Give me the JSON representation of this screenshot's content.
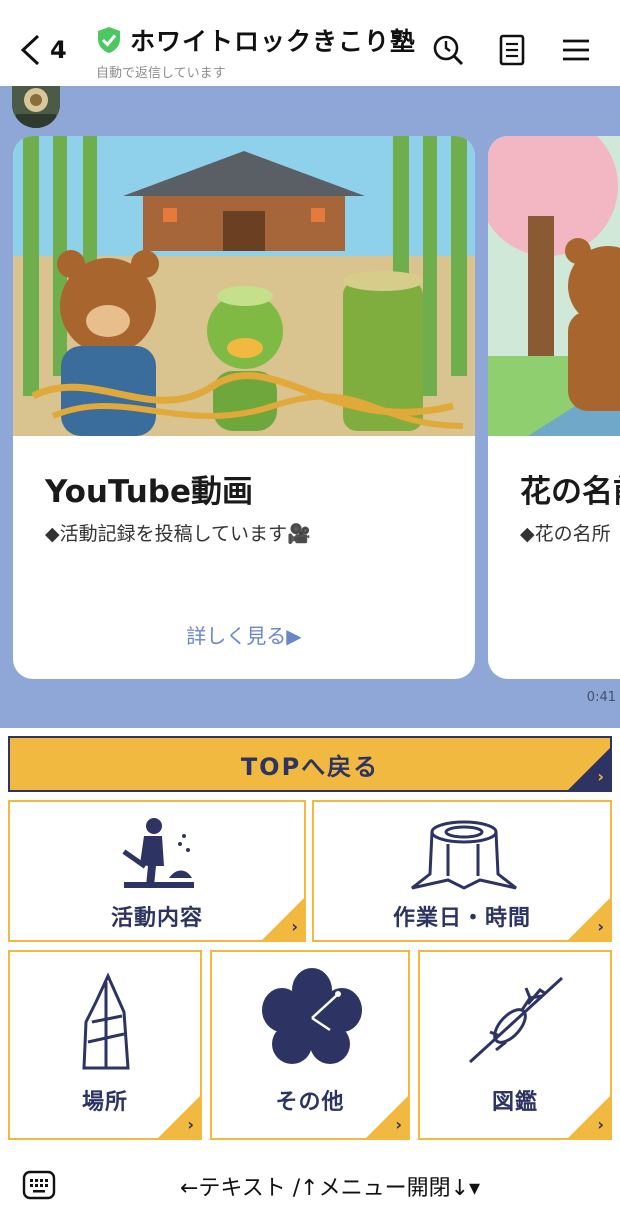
{
  "header": {
    "back_count": "4",
    "title": "ホワイトロックきこり塾",
    "subtitle": "自動で返信しています"
  },
  "chat": {
    "cards": [
      {
        "title": "YouTube動画",
        "description": "◆活動記録を投稿しています🎥",
        "link": "詳しく見る▶"
      },
      {
        "title": "花の名前",
        "description": "◆花の名所",
        "link": ""
      }
    ],
    "timestamp": "0:41"
  },
  "rich_menu": {
    "top_button": "TOPへ戻る",
    "tiles": {
      "activities": "活動内容",
      "schedule": "作業日・時間",
      "place": "場所",
      "other": "その他",
      "guide": "図鑑"
    }
  },
  "bottom_bar": {
    "menu_toggle": "←テキスト /↑メニュー開閉↓▾"
  },
  "colors": {
    "chat_background": "#8ea7d6",
    "menu_yellow": "#f2b940",
    "menu_navy": "#2d3463",
    "link_blue": "#6b86c8",
    "verified_green": "#4cc764"
  },
  "icons": [
    "back-chevron-icon",
    "shield-check-icon",
    "search-history-icon",
    "notes-icon",
    "hamburger-menu-icon",
    "keyboard-icon"
  ]
}
